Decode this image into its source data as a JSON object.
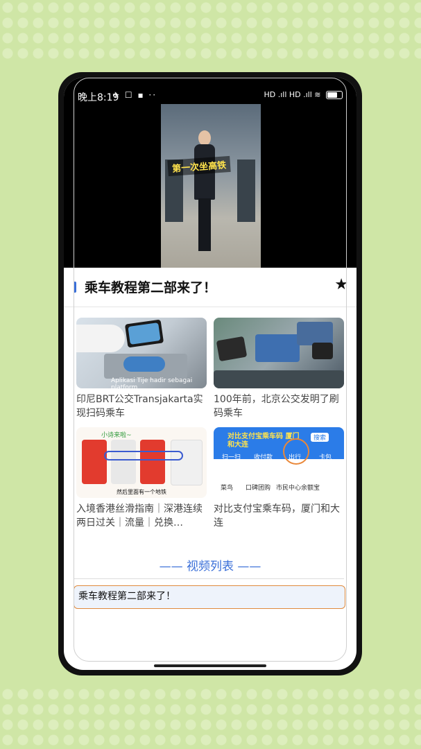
{
  "status_bar": {
    "time": "晚上8:19",
    "signal": "HD .ıll HD .ıll"
  },
  "video": {
    "overlay_caption": "第一次坐高铁"
  },
  "header": {
    "title": "乘车教程第二部来了！"
  },
  "related": [
    {
      "title": "印尼BRT公交Transjakarta实现扫码乘车"
    },
    {
      "title": "100年前，北京公交发明了刷码乘车"
    },
    {
      "title": "入境香港丝滑指南｜深港连续两日过关｜流量｜兑换…"
    },
    {
      "title": "对比支付宝乘车码，厦门和大连"
    }
  ],
  "thumb_text": {
    "t1": "Aplikasi Tije hadir sebagai platform",
    "t3_top": "小诗来啦~",
    "t3_bottom": "然后里面有一个地铁",
    "t4_banner": "对比支付宝乘车码 厦门和大连",
    "t4_search": "搜索",
    "t4_icons": [
      "扫一扫",
      "收付款",
      "出行",
      "卡包"
    ],
    "t4_row": [
      "菜鸟",
      "口碑团购",
      "市民中心",
      "余额宝"
    ]
  },
  "video_list": {
    "heading": "—— 视频列表 ——",
    "items": [
      {
        "label": "乘车教程第二部来了！"
      }
    ]
  }
}
